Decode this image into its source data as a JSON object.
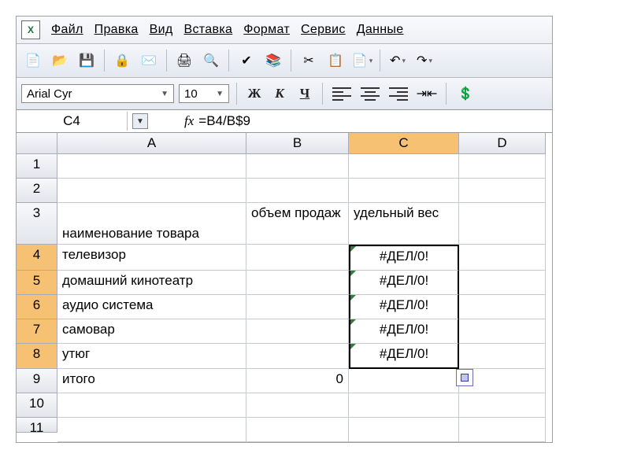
{
  "menu": {
    "file": "Файл",
    "edit": "Правка",
    "view": "Вид",
    "insert": "Вставка",
    "format": "Формат",
    "tools": "Сервис",
    "data": "Данные"
  },
  "icons": {
    "app": "X",
    "new": "📄",
    "open": "📂",
    "save": "💾",
    "permission": "🔒",
    "mail": "✉️",
    "print": "🖨",
    "preview": "🔍",
    "spell": "✔",
    "research": "📚",
    "cut": "✂",
    "copy": "📋",
    "paste": "📄",
    "undo": "↶",
    "redo": "↷"
  },
  "format_bar": {
    "font": "Arial Cyr",
    "size": "10",
    "bold": "Ж",
    "italic": "К",
    "underline": "Ч"
  },
  "fx": {
    "cell_ref": "C4",
    "label": "fx",
    "formula": "=B4/B$9"
  },
  "cols": {
    "a": "A",
    "b": "B",
    "c": "C",
    "d": "D"
  },
  "rows": {
    "1": "1",
    "2": "2",
    "3": "3",
    "4": "4",
    "5": "5",
    "6": "6",
    "7": "7",
    "8": "8",
    "9": "9",
    "10": "10",
    "11": "11"
  },
  "cells": {
    "a3": "наименование товара",
    "b3": "объем продаж",
    "c3": "удельный вес",
    "a4": "телевизор",
    "a5": "домашний кинотеатр",
    "a6": "аудио система",
    "a7": "самовар",
    "a8": "утюг",
    "a9": "итого",
    "b9": "0",
    "c4": "#ДЕЛ/0!",
    "c5": "#ДЕЛ/0!",
    "c6": "#ДЕЛ/0!",
    "c7": "#ДЕЛ/0!",
    "c8": "#ДЕЛ/0!"
  }
}
